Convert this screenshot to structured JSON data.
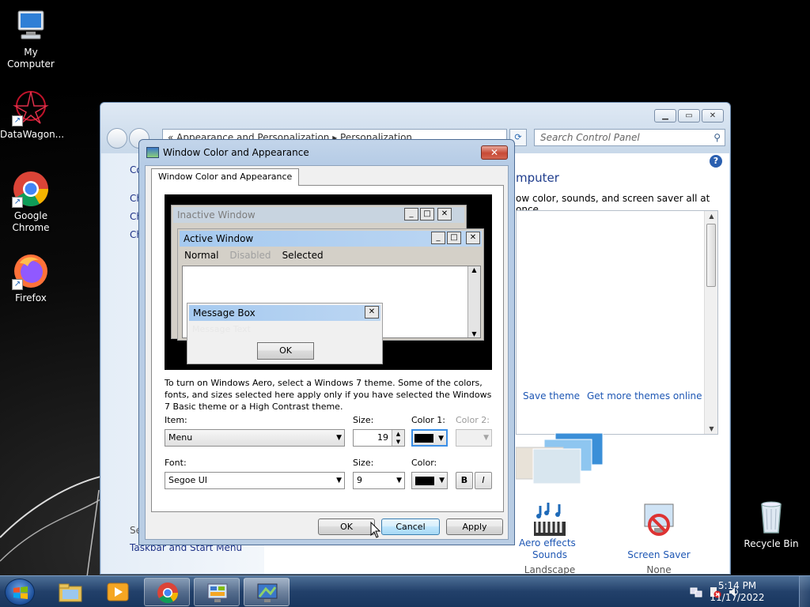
{
  "desktop": {
    "icons": [
      {
        "label": "My Computer"
      },
      {
        "label": "DataWagon..."
      },
      {
        "label": "Google Chrome"
      },
      {
        "label": "Firefox"
      },
      {
        "label": "Recycle Bin"
      }
    ]
  },
  "control_panel": {
    "address": "«  Appearance and Personalization  ▸  Personalization",
    "search_placeholder": "Search Control Panel",
    "heading_partial": "mputer",
    "subheading_partial": "ow color, sounds, and screen saver all at once.",
    "left_pane": [
      "Co",
      "Ch",
      "Ch",
      "Ch",
      "Se",
      "Taskbar and Start Menu"
    ],
    "links": {
      "save_theme": "Save theme",
      "get_more_themes": "Get more themes online"
    },
    "bottom_items": [
      {
        "title": "Sounds",
        "sub": "Landscape"
      },
      {
        "title": "Screen Saver",
        "sub": "None"
      }
    ],
    "aero_link": "Aero effects"
  },
  "dialog": {
    "title": "Window Color and Appearance",
    "tab_label": "Window Color and Appearance",
    "preview": {
      "inactive_title": "Inactive Window",
      "active_title": "Active Window",
      "menu_normal": "Normal",
      "menu_disabled": "Disabled",
      "menu_selected": "Selected",
      "msgbox_title": "Message Box",
      "msgbox_text": "Message Text",
      "msgbox_ok": "OK"
    },
    "note": "To turn on Windows Aero, select a Windows 7 theme.  Some of the colors, fonts, and sizes selected here apply only if you have selected the Windows 7 Basic theme or a High Contrast theme.",
    "item_label": "Item:",
    "item_value": "Menu",
    "size_label": "Size:",
    "size_value": "19",
    "color1_label": "Color 1:",
    "color2_label": "Color 2:",
    "font_label": "Font:",
    "font_value": "Segoe UI",
    "font_size_label": "Size:",
    "font_size_value": "9",
    "font_color_label": "Color:",
    "bold_label": "B",
    "italic_label": "I",
    "ok_label": "OK",
    "cancel_label": "Cancel",
    "apply_label": "Apply"
  },
  "taskbar": {
    "time": "5:14 PM",
    "date": "11/17/2022"
  },
  "colors": {
    "accent_title_active": "#a6caf0",
    "swatch": "#000000"
  }
}
